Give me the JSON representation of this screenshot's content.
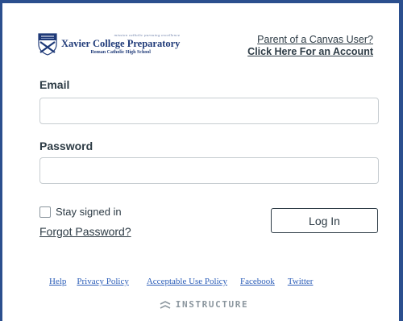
{
  "logo": {
    "tagline": "mission catholic pursuing excellence",
    "name": "Xavier College Preparatory",
    "subtitle": "Roman Catholic High School"
  },
  "parent_link": {
    "line1": "Parent of a Canvas User?",
    "line2": "Click Here For an Account"
  },
  "form": {
    "email_label": "Email",
    "email_value": "",
    "password_label": "Password",
    "password_value": "",
    "stay_signed_in_label": "Stay signed in",
    "forgot_password_label": "Forgot Password?",
    "login_label": "Log In"
  },
  "footer": {
    "links": [
      "Help",
      "Privacy Policy",
      "Acceptable Use Policy",
      "Facebook",
      "Twitter"
    ]
  },
  "brand": {
    "name": "INSTRUCTURE"
  },
  "colors": {
    "frame_border": "#2b4f8e",
    "text": "#2d3b45",
    "link": "#2b5db8",
    "brand_gray": "#8b969e"
  }
}
